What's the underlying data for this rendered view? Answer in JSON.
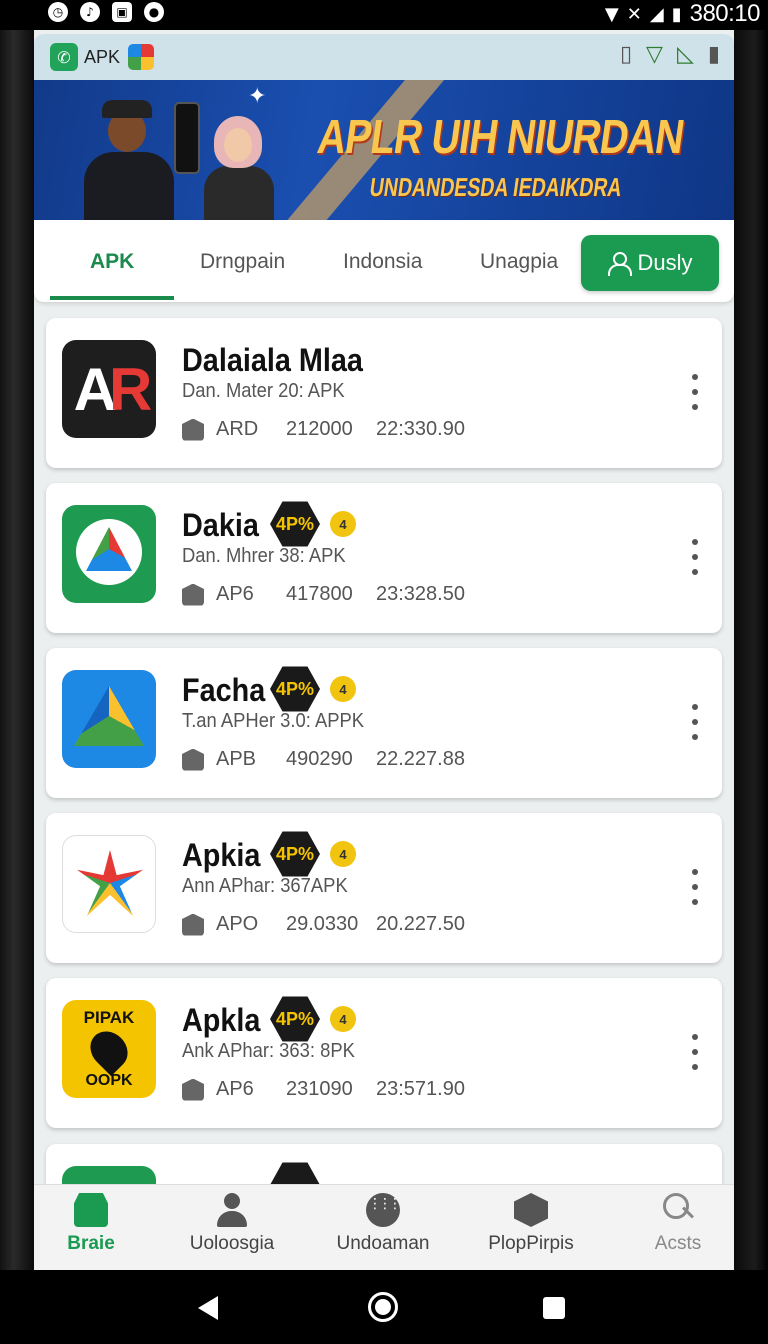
{
  "status_bar": {
    "time": "380:10",
    "left_icons": [
      "alarm-icon",
      "notification-icon",
      "app-icon",
      "sync-icon"
    ],
    "right_icons": [
      "wifi-icon",
      "data-icon",
      "signal-icon",
      "battery-icon"
    ]
  },
  "app_bar": {
    "title": "APK",
    "right_icons": [
      "window-icon",
      "wifi-icon",
      "signal-icon",
      "battery-icon"
    ]
  },
  "banner": {
    "headline": "APLR UIH NIURDAN",
    "subheadline": "UNDANDESDA IEDAIKDRA"
  },
  "tabs": {
    "items": [
      {
        "label": "APK",
        "active": true
      },
      {
        "label": "Drngpain"
      },
      {
        "label": "Indonsia"
      },
      {
        "label": "Unagpia"
      }
    ],
    "action_button": "Dusly"
  },
  "apps": [
    {
      "title": "Dalaiala Mlaa",
      "subtitle": "Dan. Mater 20: APK",
      "meta_type": "ARD",
      "meta_count": "212000",
      "meta_date": "22:330.90",
      "icon": "ar-app-icon",
      "badge": ""
    },
    {
      "title": "Dakia",
      "subtitle": "Dan. Mhrer 38: APK",
      "meta_type": "AP6",
      "meta_count": "417800",
      "meta_date": "23:328.50",
      "icon": "drive-green-icon",
      "badge": "4P%",
      "coin": "4"
    },
    {
      "title": "Facha",
      "subtitle": "T.an APHer 3.0: APPK",
      "meta_type": "APB",
      "meta_count": "490290",
      "meta_date": "22.227.88",
      "icon": "drive-blue-icon",
      "badge": "4P%",
      "coin": "4"
    },
    {
      "title": "Apkia",
      "subtitle": "Ann APhar: 367APK",
      "meta_type": "APO",
      "meta_count": "29.0330",
      "meta_date": "20.227.50",
      "icon": "star-burst-icon",
      "badge": "4P%",
      "coin": "4"
    },
    {
      "title": "Apkla",
      "subtitle": "Ank APhar: 363: 8PK",
      "meta_type": "AP6",
      "meta_count": "231090",
      "meta_date": "23:571.90",
      "icon": "pipak-icon",
      "badge": "4P%",
      "coin": "4",
      "icon_text_top": "PIPAK",
      "icon_text_bottom": "OOPK"
    }
  ],
  "bottom_nav": [
    {
      "label": "Braie",
      "icon": "store-icon",
      "active": true
    },
    {
      "label": "Uoloosgia",
      "icon": "person-icon"
    },
    {
      "label": "Undoaman",
      "icon": "grid-icon"
    },
    {
      "label": "PlopPirpis",
      "icon": "box-icon"
    },
    {
      "label": "Acsts",
      "icon": "search-icon"
    }
  ],
  "colors": {
    "accent_green": "#1b9a52",
    "banner_blue": "#1a4fb0",
    "banner_text": "#f9c74f",
    "badge_dark": "#1a1a1a",
    "coin_yellow": "#f1c40f"
  }
}
